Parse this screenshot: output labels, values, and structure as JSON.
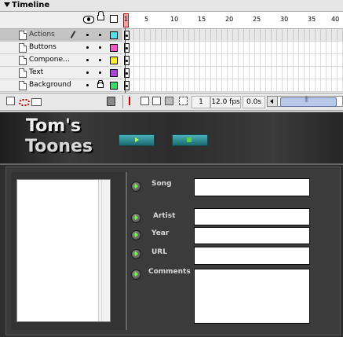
{
  "timeline": {
    "title": "Timeline",
    "ruler_labels": [
      "1",
      "5",
      "10",
      "15",
      "20",
      "25",
      "30",
      "35",
      "40"
    ],
    "layers": [
      {
        "name": "Actions",
        "color": "#55ddee",
        "selected": true,
        "locked": false
      },
      {
        "name": "Buttons",
        "color": "#ff55cc",
        "selected": false,
        "locked": false
      },
      {
        "name": "Compone…",
        "color": "#ffee33",
        "selected": false,
        "locked": false
      },
      {
        "name": "Text",
        "color": "#aa44dd",
        "selected": false,
        "locked": false
      },
      {
        "name": "Background",
        "color": "#33dd66",
        "selected": false,
        "locked": true
      }
    ],
    "current_frame": "1",
    "frame_rate": "12.0 fps",
    "elapsed_time": "0.0s"
  },
  "stage": {
    "logo_line1": "Tom's",
    "logo_line2": "Toones",
    "fields": [
      {
        "label": "Song"
      },
      {
        "label": "Artist"
      },
      {
        "label": "Year"
      },
      {
        "label": "URL"
      },
      {
        "label": "Comments"
      }
    ]
  },
  "colors": {
    "accent_button": "#2a8890",
    "bullet_arrow": "#70ff30",
    "stage_bg": "#2e2e2e"
  }
}
